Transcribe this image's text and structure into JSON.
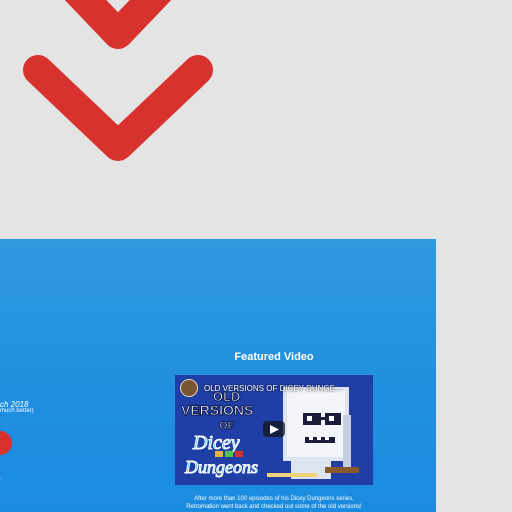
{
  "colors": {
    "page_background": "#e4e4e4",
    "accent_red": "#d8322f",
    "panel_blue": "#1f8edf"
  },
  "icons": {
    "scroll_indicator": "double-chevron-down-icon",
    "play": "play-icon"
  },
  "sidebar_left": {
    "date_fragment": "ch 2018",
    "note_fragment": "much better)",
    "dot": "."
  },
  "featured": {
    "heading": "Featured Video",
    "video_title": "OLD VERSIONS OF DICEY DUNGE...",
    "caption_line1": "After more than 100 episodes of his Dicey Dungeons series,",
    "caption_line2": "Retromation went back and checked out some of the old versions!"
  },
  "thumbnail_art_text": {
    "line1": "OLD",
    "line2": "VERSIONS",
    "line3": "OF",
    "line4": "Dicey",
    "line5": "Dungeons"
  }
}
